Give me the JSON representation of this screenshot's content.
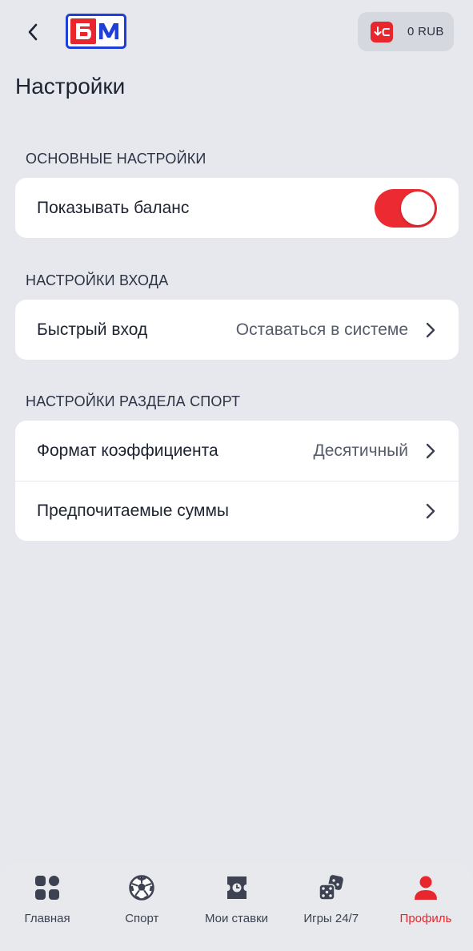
{
  "header": {
    "logo_text": "БМ",
    "balance": "0 RUB"
  },
  "page": {
    "title": "Настройки"
  },
  "sections": [
    {
      "title": "ОСНОВНЫЕ НАСТРОЙКИ",
      "rows": [
        {
          "label": "Показывать баланс",
          "toggle_on": true
        }
      ]
    },
    {
      "title": "НАСТРОЙКИ ВХОДА",
      "rows": [
        {
          "label": "Быстрый вход",
          "value": "Оставаться в системе"
        }
      ]
    },
    {
      "title": "НАСТРОЙКИ РАЗДЕЛА СПОРТ",
      "rows": [
        {
          "label": "Формат коэффициента",
          "value": "Десятичный"
        },
        {
          "label": "Предпочитаемые суммы",
          "value": ""
        }
      ]
    }
  ],
  "tabbar": {
    "items": [
      {
        "label": "Главная",
        "icon": "grid-icon",
        "active": false
      },
      {
        "label": "Спорт",
        "icon": "soccer-ball-icon",
        "active": false
      },
      {
        "label": "Мои ставки",
        "icon": "ticket-icon",
        "active": false
      },
      {
        "label": "Игры 24/7",
        "icon": "dice-icon",
        "active": false
      },
      {
        "label": "Профиль",
        "icon": "person-icon",
        "active": true
      }
    ]
  },
  "colors": {
    "accent": "#e8262e",
    "background": "#e6e8ed",
    "logo_blue": "#1f3fd6"
  }
}
